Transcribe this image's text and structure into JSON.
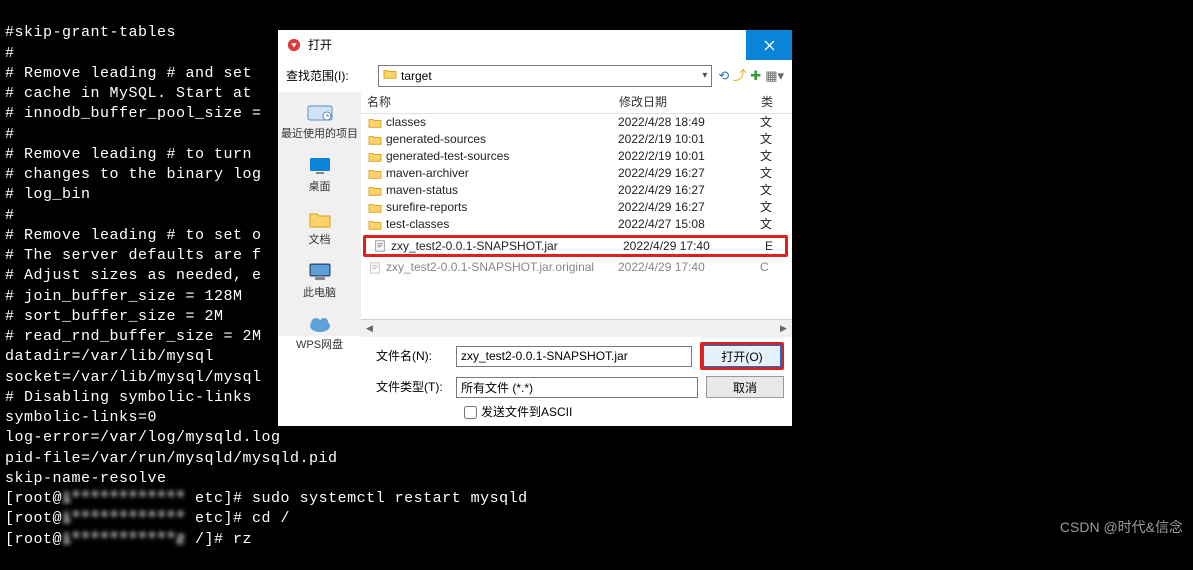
{
  "terminal": {
    "lines": [
      "#skip-grant-tables",
      "#",
      "# Remove leading # and set ",
      "# cache in MySQL. Start at ",
      "# innodb_buffer_pool_size =",
      "#",
      "# Remove leading # to turn ",
      "# changes to the binary log",
      "# log_bin",
      "#",
      "# Remove leading # to set o",
      "# The server defaults are f",
      "# Adjust sizes as needed, e",
      "# join_buffer_size = 128M",
      "# sort_buffer_size = 2M",
      "# read_rnd_buffer_size = 2M",
      "datadir=/var/lib/mysql",
      "socket=/var/lib/mysql/mysql",
      "",
      "# Disabling symbolic-links ",
      "symbolic-links=0",
      "",
      "log-error=/var/log/mysqld.log",
      "pid-file=/var/run/mysqld/mysqld.pid",
      "skip-name-resolve"
    ],
    "prompt1_pre": "[root@",
    "prompt1_host": "i************",
    "prompt1_path": " etc]# sudo systemctl restart mysqld",
    "prompt2_pre": "[root@",
    "prompt2_host": "i************",
    "prompt2_path": " etc]# cd /",
    "prompt3_pre": "[root@",
    "prompt3_host": "i***********z",
    "prompt3_path": " /]# rz"
  },
  "dialog": {
    "title": "打开",
    "path_label": "查找范围(I):",
    "path_value": "target",
    "headers": {
      "name": "名称",
      "date": "修改日期",
      "type": "类"
    },
    "sidebar": [
      {
        "key": "recent",
        "label": "最近使用的项目"
      },
      {
        "key": "desktop",
        "label": "桌面"
      },
      {
        "key": "documents",
        "label": "文档"
      },
      {
        "key": "thispc",
        "label": "此电脑"
      },
      {
        "key": "wps",
        "label": "WPS网盘"
      }
    ],
    "files": [
      {
        "icon": "folder",
        "name": "classes",
        "date": "2022/4/28 18:49",
        "type": "文"
      },
      {
        "icon": "folder",
        "name": "generated-sources",
        "date": "2022/2/19 10:01",
        "type": "文"
      },
      {
        "icon": "folder",
        "name": "generated-test-sources",
        "date": "2022/2/19 10:01",
        "type": "文"
      },
      {
        "icon": "folder",
        "name": "maven-archiver",
        "date": "2022/4/29 16:27",
        "type": "文"
      },
      {
        "icon": "folder",
        "name": "maven-status",
        "date": "2022/4/29 16:27",
        "type": "文"
      },
      {
        "icon": "folder",
        "name": "surefire-reports",
        "date": "2022/4/29 16:27",
        "type": "文"
      },
      {
        "icon": "folder",
        "name": "test-classes",
        "date": "2022/4/27 15:08",
        "type": "文"
      }
    ],
    "highlight_file": {
      "icon": "file",
      "name": "zxy_test2-0.0.1-SNAPSHOT.jar",
      "date": "2022/4/29 17:40",
      "type": "E"
    },
    "file_after": {
      "icon": "file",
      "name": "zxy_test2-0.0.1-SNAPSHOT.jar.original",
      "date": "2022/4/29 17:40",
      "type": "C"
    },
    "filename_label": "文件名(N):",
    "filename_value": "zxy_test2-0.0.1-SNAPSHOT.jar",
    "filetype_label": "文件类型(T):",
    "filetype_value": "所有文件 (*.*)",
    "open_btn": "打开(O)",
    "cancel_btn": "取消",
    "ascii_checkbox": "发送文件到ASCII"
  },
  "watermark": "CSDN @时代&信念"
}
